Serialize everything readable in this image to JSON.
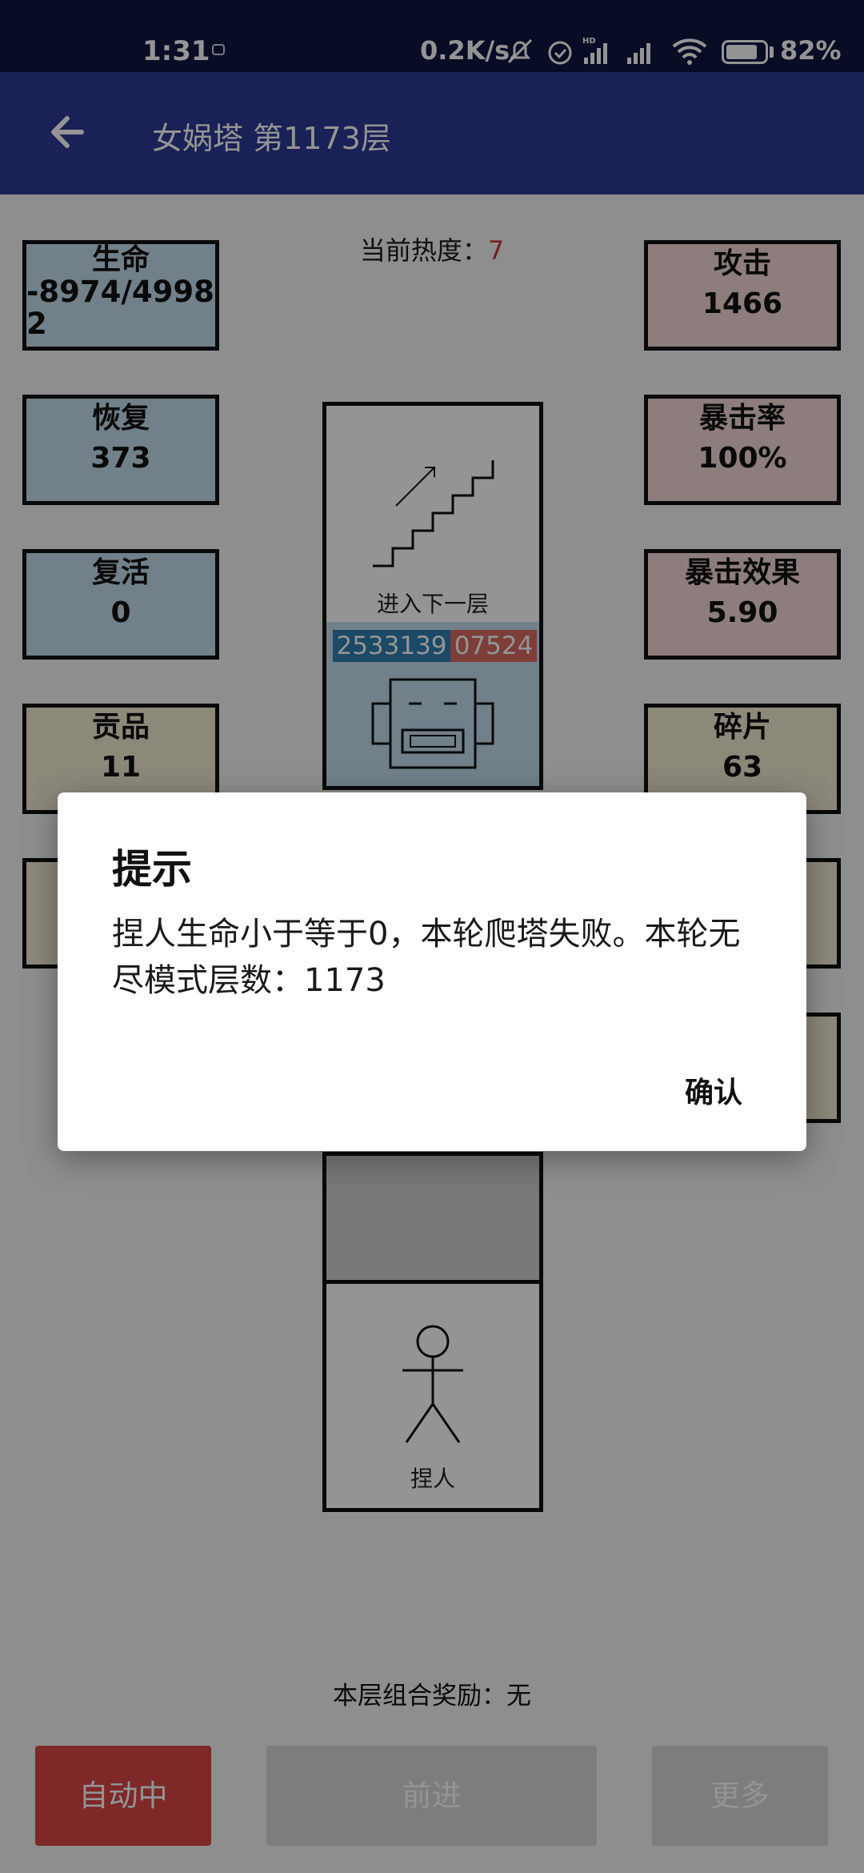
{
  "status_bar": {
    "time": "1:31",
    "speed": "0.2K/s",
    "battery": "82%",
    "battery_level": 0.82
  },
  "app_bar": {
    "title": "女娲塔 第1173层"
  },
  "game": {
    "heat_label": "当前热度：",
    "heat_value": "7",
    "stats_left": [
      {
        "label": "生命",
        "value": "-8974/49982"
      },
      {
        "label": "恢复",
        "value": "373"
      },
      {
        "label": "复活",
        "value": "0"
      },
      {
        "label": "贡品",
        "value": "11"
      }
    ],
    "stats_right": [
      {
        "label": "攻击",
        "value": "1466"
      },
      {
        "label": "暴击率",
        "value": "100%"
      },
      {
        "label": "暴击效果",
        "value": "5.90"
      },
      {
        "label": "碎片",
        "value": "63"
      }
    ],
    "stairs_label": "进入下一层",
    "enemy_hp_a": "2533139",
    "enemy_hp_b": "07524",
    "player_label": "捏人",
    "combo_reward": "本层组合奖励：无"
  },
  "buttons": {
    "auto": "自动中",
    "forward": "前进",
    "more": "更多"
  },
  "dialog": {
    "title": "提示",
    "message": "捏人生命小于等于0，本轮爬塔失败。本轮无尽模式层数：1173",
    "confirm": "确认"
  },
  "colors": {
    "app_bar": "#2c3a94",
    "status_bar": "#0f1840",
    "auto_button": "#d94545",
    "heat_value": "#c23b3b"
  }
}
